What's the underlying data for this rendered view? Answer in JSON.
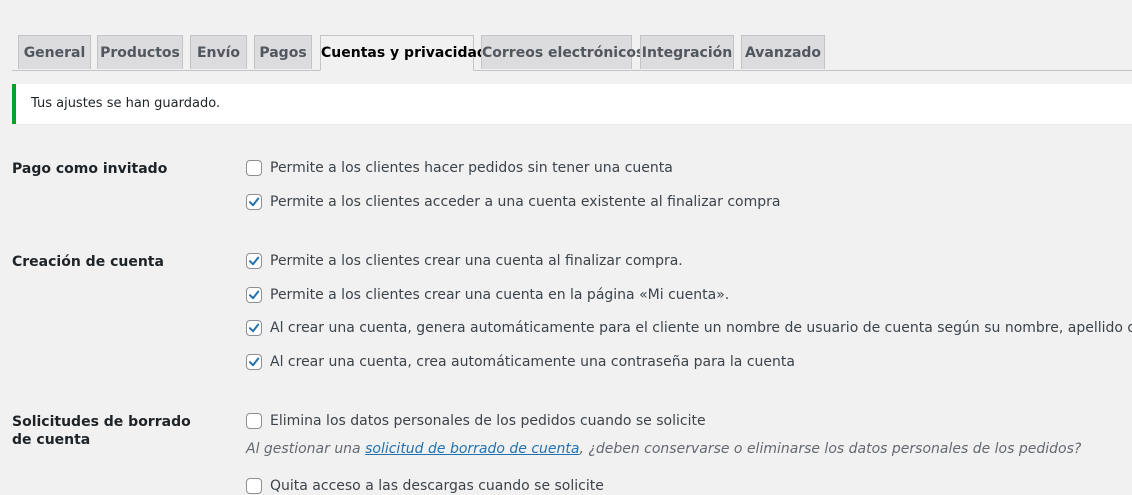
{
  "tabs": [
    {
      "label": "General",
      "active": false
    },
    {
      "label": "Productos",
      "active": false
    },
    {
      "label": "Envío",
      "active": false
    },
    {
      "label": "Pagos",
      "active": false
    },
    {
      "label": "Cuentas y privacidad",
      "active": true
    },
    {
      "label": "Correos electrónicos",
      "active": false
    },
    {
      "label": "Integración",
      "active": false
    },
    {
      "label": "Avanzado",
      "active": false
    }
  ],
  "notice": {
    "text": "Tus ajustes se han guardado.",
    "accent_color": "#00a32a"
  },
  "sections": {
    "guest_checkout": {
      "label": "Pago como invitado",
      "options": [
        {
          "label": "Permite a los clientes hacer pedidos sin tener una cuenta",
          "checked": false
        },
        {
          "label": "Permite a los clientes acceder a una cuenta existente al finalizar compra",
          "checked": true
        }
      ]
    },
    "account_creation": {
      "label": "Creación de cuenta",
      "options": [
        {
          "label": "Permite a los clientes crear una cuenta al finalizar compra.",
          "checked": true
        },
        {
          "label": "Permite a los clientes crear una cuenta en la página «Mi cuenta».",
          "checked": true
        },
        {
          "label": "Al crear una cuenta, genera automáticamente para el cliente un nombre de usuario de cuenta según su nombre, apellido o correo electrónico",
          "checked": true
        },
        {
          "label": "Al crear una cuenta, crea automáticamente una contraseña para la cuenta",
          "checked": true
        }
      ]
    },
    "erasure_requests": {
      "label": "Solicitudes de borrado de cuenta",
      "options": [
        {
          "label": "Elimina los datos personales de los pedidos cuando se solicite",
          "checked": false
        },
        {
          "label": "Quita acceso a las descargas cuando se solicite",
          "checked": false
        }
      ],
      "description": {
        "prefix": "Al gestionar una ",
        "link_text": "solicitud de borrado de cuenta",
        "suffix": ", ¿deben conservarse o eliminarse los datos personales de los pedidos?"
      }
    }
  },
  "colors": {
    "checkmark": "#2271b1",
    "link": "#2271b1"
  }
}
